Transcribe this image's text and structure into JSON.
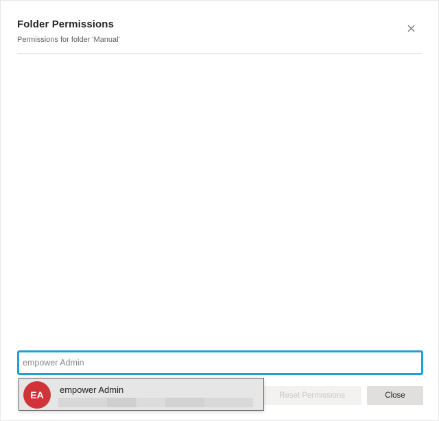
{
  "dialog": {
    "title": "Folder Permissions",
    "subtitle": "Permissions for folder 'Manual'",
    "close_icon": "close-icon"
  },
  "search": {
    "value": "",
    "placeholder": "empower Admin",
    "focus_color": "#1aa3d4"
  },
  "suggestions": [
    {
      "initials": "EA",
      "name": "empower Admin",
      "avatar_color": "#d13438"
    }
  ],
  "footer": {
    "reset_label": "Reset Permissions",
    "close_label": "Close"
  }
}
